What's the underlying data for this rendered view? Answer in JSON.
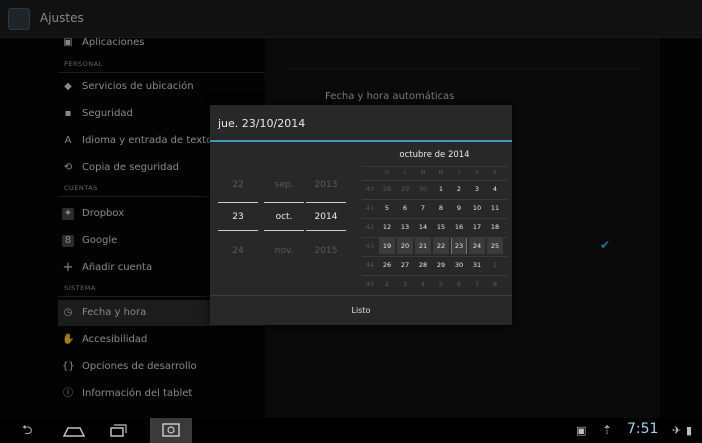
{
  "actionbar": {
    "title": "Ajustes"
  },
  "sidebar": {
    "items_partial": "Aplicaciones",
    "sections": {
      "personal": "PERSONAL",
      "cuentas": "CUENTAS",
      "sistema": "SISTEMA"
    },
    "personal_items": [
      {
        "label": "Servicios de ubicación",
        "icon": "location-icon"
      },
      {
        "label": "Seguridad",
        "icon": "lock-icon"
      },
      {
        "label": "Idioma y entrada de texto",
        "icon": "language-icon"
      },
      {
        "label": "Copia de seguridad",
        "icon": "backup-icon"
      }
    ],
    "account_items": [
      {
        "label": "Dropbox",
        "icon": "dropbox-icon"
      },
      {
        "label": "Google",
        "icon": "google-icon"
      },
      {
        "label": "Añadir cuenta",
        "icon": "add-icon"
      }
    ],
    "system_items": [
      {
        "label": "Fecha y hora",
        "icon": "clock-icon",
        "active": true
      },
      {
        "label": "Accesibilidad",
        "icon": "accessibility-icon"
      },
      {
        "label": "Opciones de desarrollo",
        "icon": "braces-icon"
      },
      {
        "label": "Información del tablet",
        "icon": "info-icon"
      }
    ]
  },
  "detail": {
    "auto_datetime": "Fecha y hora automáticas",
    "checked_color": "#33b5e5"
  },
  "dialog": {
    "title": "jue. 23/10/2014",
    "spinners": {
      "day": {
        "prev": "22",
        "current": "23",
        "next": "24"
      },
      "month": {
        "prev": "sep.",
        "current": "oct.",
        "next": "nov."
      },
      "year": {
        "prev": "2013",
        "current": "2014",
        "next": "2015"
      }
    },
    "calendar": {
      "month_title": "octubre de 2014",
      "weekdays": [
        "D",
        "L",
        "M",
        "M",
        "J",
        "V",
        "S"
      ],
      "rows": [
        {
          "week": "40",
          "days": [
            "28",
            "29",
            "30",
            "1",
            "2",
            "3",
            "4"
          ]
        },
        {
          "week": "41",
          "days": [
            "5",
            "6",
            "7",
            "8",
            "9",
            "10",
            "11"
          ]
        },
        {
          "week": "42",
          "days": [
            "12",
            "13",
            "14",
            "15",
            "16",
            "17",
            "18"
          ]
        },
        {
          "week": "43",
          "days": [
            "19",
            "20",
            "21",
            "22",
            "23",
            "24",
            "25"
          ]
        },
        {
          "week": "44",
          "days": [
            "26",
            "27",
            "28",
            "29",
            "30",
            "31",
            "1"
          ]
        },
        {
          "week": "45",
          "days": [
            "2",
            "3",
            "4",
            "5",
            "6",
            "7",
            "8"
          ]
        }
      ]
    },
    "done_label": "Listo",
    "accent_color": "#3a9bc2"
  },
  "statusbar": {
    "clock": "7:51"
  }
}
